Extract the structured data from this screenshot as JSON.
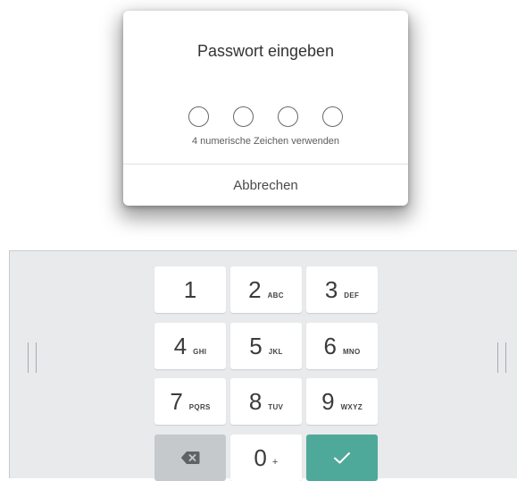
{
  "dialog": {
    "title": "Passwort eingeben",
    "pin_length": 4,
    "hint": "4 numerische Zeichen verwenden",
    "cancel_label": "Abbrechen"
  },
  "keypad": {
    "keys": [
      {
        "digit": "1",
        "letters": ""
      },
      {
        "digit": "2",
        "letters": "ABC"
      },
      {
        "digit": "3",
        "letters": "DEF"
      },
      {
        "digit": "4",
        "letters": "GHI"
      },
      {
        "digit": "5",
        "letters": "JKL"
      },
      {
        "digit": "6",
        "letters": "MNO"
      },
      {
        "digit": "7",
        "letters": "PQRS"
      },
      {
        "digit": "8",
        "letters": "TUV"
      },
      {
        "digit": "9",
        "letters": "WXYZ"
      },
      {
        "digit": "0",
        "letters": "+"
      }
    ],
    "backspace_icon": "backspace-icon",
    "confirm_icon": "checkmark-icon",
    "confirm_color": "#4fa99a",
    "backspace_color": "#c6c9cc"
  }
}
